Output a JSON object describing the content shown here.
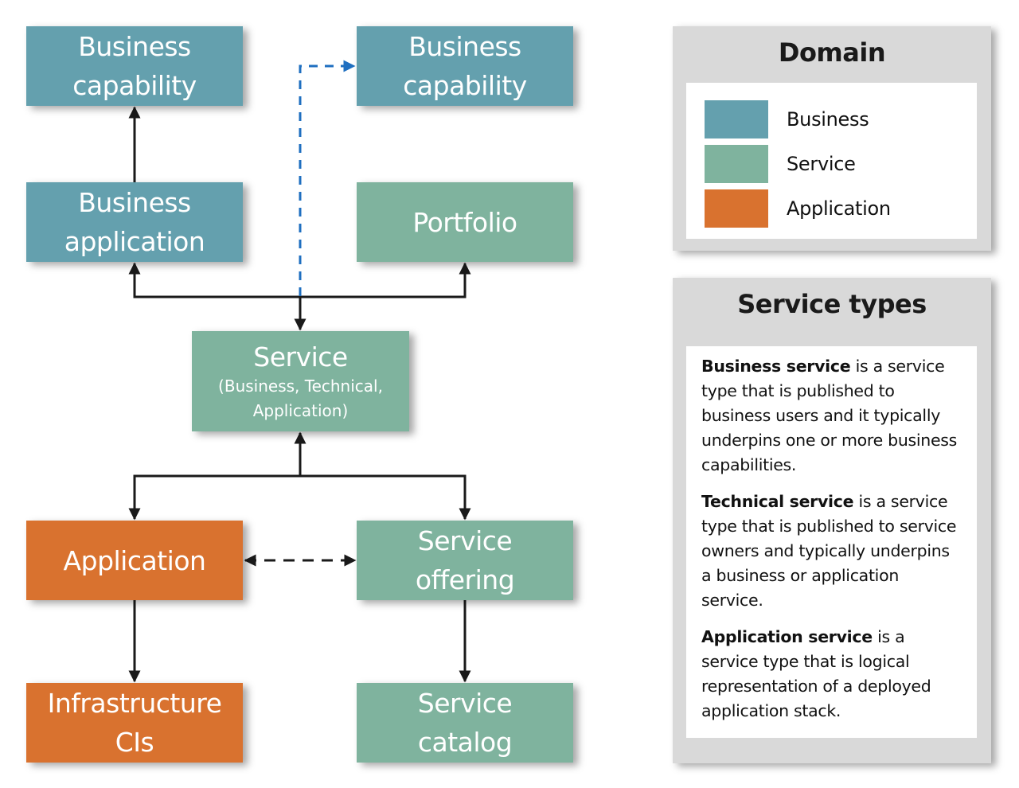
{
  "colors": {
    "business": "#64a0ae",
    "service": "#7fb39e",
    "application": "#d9722f",
    "connector": "#1a1a1a",
    "dashed_link": "#1f6fc0",
    "panel_bg": "#d9d9d9"
  },
  "nodes": {
    "business_capability_left": {
      "line1": "Business",
      "line2": "capability",
      "domain": "business"
    },
    "business_capability_right": {
      "line1": "Business",
      "line2": "capability",
      "domain": "business"
    },
    "business_application": {
      "line1": "Business",
      "line2": "application",
      "domain": "business"
    },
    "portfolio": {
      "line1": "Portfolio",
      "domain": "service"
    },
    "service": {
      "line1": "Service",
      "line2": "(Business, Technical,",
      "line3": "Application)",
      "domain": "service"
    },
    "application": {
      "line1": "Application",
      "domain": "application"
    },
    "service_offering": {
      "line1": "Service",
      "line2": "offering",
      "domain": "service"
    },
    "infrastructure_cis": {
      "line1": "Infrastructure",
      "line2": "CIs",
      "domain": "application"
    },
    "service_catalog": {
      "line1": "Service",
      "line2": "catalog",
      "domain": "service"
    }
  },
  "edges": [
    {
      "from": "business_application",
      "to": "business_capability_left",
      "style": "solid"
    },
    {
      "from": "service",
      "to": "business_application",
      "style": "solid"
    },
    {
      "from": "service",
      "to": "portfolio",
      "style": "solid"
    },
    {
      "from": "service",
      "to": "business_capability_right",
      "style": "dashed-blue"
    },
    {
      "from": "application",
      "to": "service",
      "style": "solid"
    },
    {
      "from": "service_offering",
      "to": "service",
      "style": "solid"
    },
    {
      "from": "application",
      "to": "service_offering",
      "style": "dashed-bidirectional"
    },
    {
      "from": "application",
      "to": "infrastructure_cis",
      "style": "solid"
    },
    {
      "from": "service_offering",
      "to": "service_catalog",
      "style": "solid"
    }
  ],
  "domain_legend": {
    "title": "Domain",
    "items": [
      {
        "label": "Business",
        "color": "#64a0ae"
      },
      {
        "label": "Service",
        "color": "#7fb39e"
      },
      {
        "label": "Application",
        "color": "#d9722f"
      }
    ]
  },
  "service_types": {
    "title": "Service types",
    "items": [
      {
        "term": "Business service",
        "description": " is a service type that is published to business users and it typically underpins one or more business capabilities."
      },
      {
        "term": "Technical service",
        "description": " is a service type that is published to service owners and typically underpins a business or application service."
      },
      {
        "term": "Application service",
        "description": " is a service type that is logical representation of a deployed application stack."
      }
    ]
  }
}
